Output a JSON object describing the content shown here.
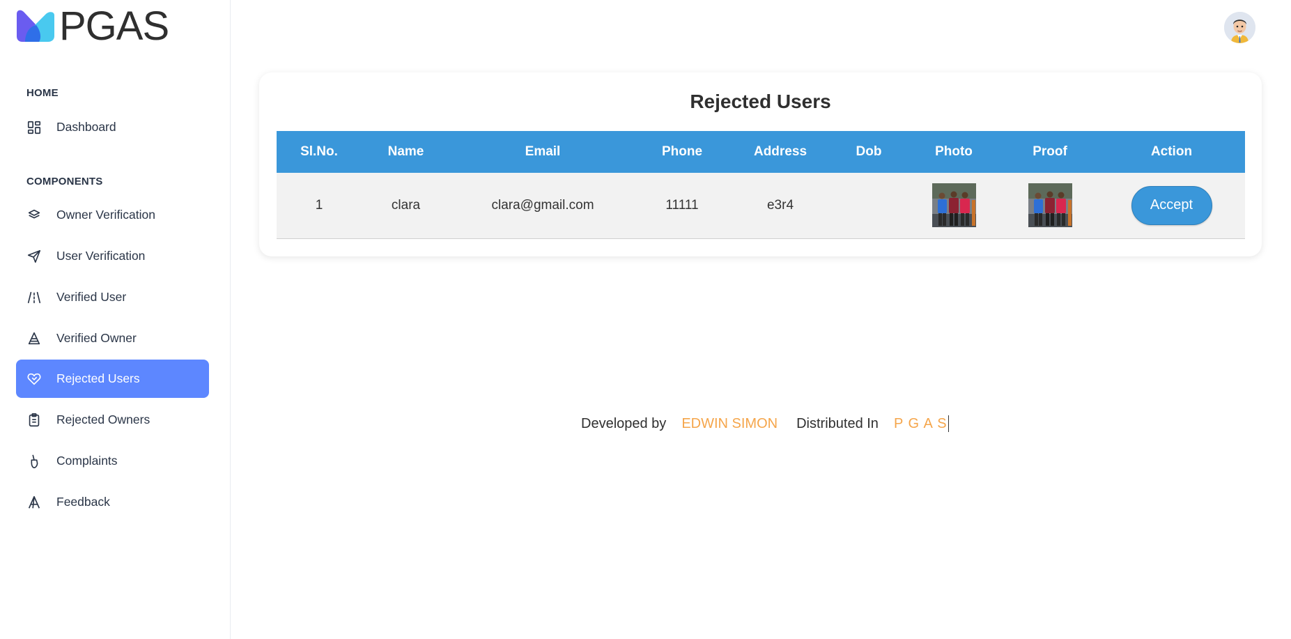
{
  "app": {
    "logo_text": "PGAS"
  },
  "sidebar": {
    "sections": [
      {
        "title": "HOME"
      },
      {
        "title": "COMPONENTS"
      }
    ],
    "items": [
      {
        "label": "Dashboard",
        "icon": "dashboard-icon"
      },
      {
        "label": "Owner Verification",
        "icon": "layers-icon"
      },
      {
        "label": "User Verification",
        "icon": "send-icon"
      },
      {
        "label": "Verified User",
        "icon": "road-icon"
      },
      {
        "label": "Verified Owner",
        "icon": "cone-icon"
      },
      {
        "label": "Rejected Users",
        "icon": "heart-handshake-icon",
        "active": true
      },
      {
        "label": "Rejected Owners",
        "icon": "clipboard-icon"
      },
      {
        "label": "Complaints",
        "icon": "brush-icon"
      },
      {
        "label": "Feedback",
        "icon": "letter-a-icon"
      }
    ]
  },
  "header": {
    "avatar_icon": "user-avatar"
  },
  "main": {
    "title": "Rejected Users",
    "table": {
      "columns": [
        "Sl.No.",
        "Name",
        "Email",
        "Phone",
        "Address",
        "Dob",
        "Photo",
        "Proof",
        "Action"
      ],
      "rows": [
        {
          "slno": "1",
          "name": "clara",
          "email": "clara@gmail.com",
          "phone": "11111",
          "address": "e3r4",
          "dob": "",
          "action_label": "Accept"
        }
      ]
    }
  },
  "footer": {
    "developed_label": "Developed by",
    "developer": "EDWIN SIMON",
    "distributed_label": "Distributed In",
    "distributor": "P G A S"
  },
  "colors": {
    "accent": "#5d87ff",
    "table_header": "#3a97da",
    "highlight": "#f5a54a"
  }
}
